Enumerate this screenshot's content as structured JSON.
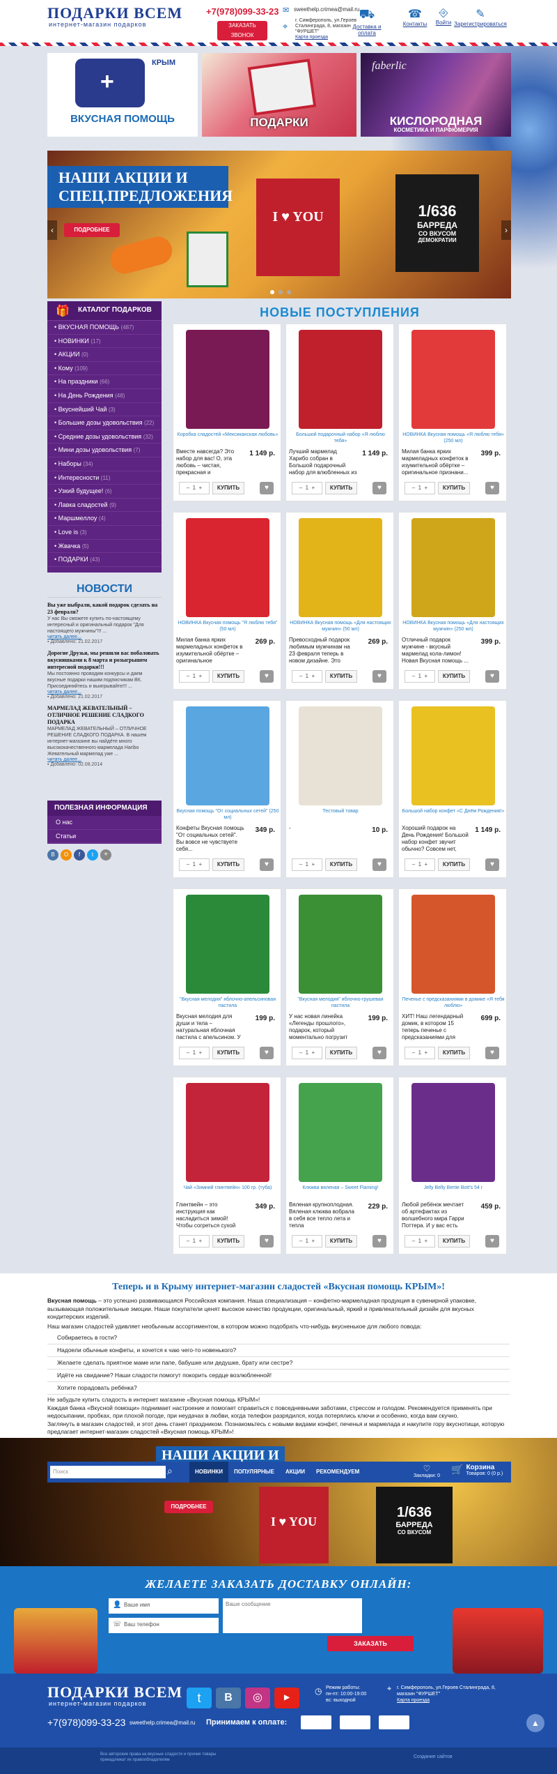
{
  "header": {
    "logo_title": "ПОДАРКИ ВСЕМ",
    "logo_subtitle": "интернет-магазин подарков",
    "phone": "+7(978)099-33-23",
    "callback_label": "ЗАКАЗАТЬ ЗВОНОК",
    "email": "sweethelp.crimea@mail.ru",
    "address_lines": [
      "г. Симферополь, ул.Героев",
      "Сталинграда, 8, магазин",
      "\"ФУРШЕТ\""
    ],
    "map_link": "Карта проезда",
    "nav": [
      "Доставка и оплата",
      "Контакты",
      "Войти",
      "Зарегистрироваться"
    ]
  },
  "banners": [
    {
      "title": "ВКУСНАЯ ПОМОЩЬ",
      "top_label": "КРЫМ"
    },
    {
      "title": "ПОДАРКИ"
    },
    {
      "title": "КИСЛОРОДНАЯ",
      "subtitle": "КОСМЕТИКА И ПАРФЮМЕРИЯ",
      "brand": "faberlic"
    }
  ],
  "slider": {
    "title_line1": "НАШИ АКЦИИ И",
    "title_line2": "СПЕЦ.ПРЕДЛОЖЕНИЯ",
    "button": "ПОДРОБНЕЕ",
    "box1": "I ♥ YOU",
    "box2_line1": "1/636",
    "box2_line2": "БАРРЕДА",
    "box2_line3": "СО ВКУСОМ",
    "box2_line4": "ДЕМОКРАТИИ"
  },
  "catalog": {
    "title": "КАТАЛОГ ПОДАРКОВ",
    "items": [
      {
        "label": "ВКУСНАЯ ПОМОЩЬ",
        "count": "(487)"
      },
      {
        "label": "НОВИНКИ",
        "count": "(17)"
      },
      {
        "label": "АКЦИИ",
        "count": "(0)"
      },
      {
        "label": "Кому",
        "count": "(109)"
      },
      {
        "label": "На праздники",
        "count": "(66)"
      },
      {
        "label": "На День Рождения",
        "count": "(48)"
      },
      {
        "label": "Вкуснейший Чай",
        "count": "(3)"
      },
      {
        "label": "Большие дозы удовольствия",
        "count": "(22)"
      },
      {
        "label": "Средние дозы удовольствия",
        "count": "(32)"
      },
      {
        "label": "Мини дозы удовольствия",
        "count": "(7)"
      },
      {
        "label": "Наборы",
        "count": "(34)"
      },
      {
        "label": "Интересности",
        "count": "(11)"
      },
      {
        "label": "Узкий будущее!",
        "count": "(6)"
      },
      {
        "label": "Лавка сладостей",
        "count": "(9)"
      },
      {
        "label": "Маршмеллоу",
        "count": "(4)"
      },
      {
        "label": "Love is",
        "count": "(3)"
      },
      {
        "label": "Жвачка",
        "count": "(5)"
      },
      {
        "label": "ПОДАРКИ",
        "count": "(43)"
      }
    ]
  },
  "news": {
    "title": "НОВОСТИ",
    "items": [
      {
        "title": "Вы уже выбрали, какой подарок сделать на 23 февраля?",
        "text": "У нас Вы сможете купить по-настоящему интересный и оригинальный подарок \"Для настоящего мужчины\"!!! ...",
        "more": "читать далее...",
        "date": "Добавлено: 21.02.2017"
      },
      {
        "title": "Дорогие Друзья, мы решили вас побаловать вкусняшками к 8 марта и розыгрышем интересной подарки!!!",
        "text": "Мы постоянно проводим конкурсы и даем вкусные подарки нашим подписчикам ВК. Присоединяйтесь и выигрывайте!!! ...",
        "more": "читать далее...",
        "date": "Добавлено: 21.02.2017"
      },
      {
        "title": "МАРМЕЛАД ЖЕВАТЕЛЬНЫЙ – ОТЛИЧНОЕ РЕШЕНИЕ СЛАДКОГО ПОДАРКА",
        "text": "МАРМЕЛАД ЖЕВАТЕЛЬНЫЙ – ОТЛИЧНОЕ РЕШЕНИЕ СЛАДКОГО ПОДАРКА. В нашем интернет-магазине вы найдёте много высококачественного мармелада Haribo Жевательный мармелад уже ...",
        "more": "читать далее...",
        "date": "Добавлено: 02.08.2014"
      }
    ]
  },
  "info": {
    "title": "ПОЛЕЗНАЯ ИНФОРМАЦИЯ",
    "items": [
      "О нас",
      "Статьи"
    ]
  },
  "new_arrivals": {
    "title": "НОВЫЕ ПОСТУПЛЕНИЯ",
    "qty_default": "1",
    "buy_label": "КУПИТЬ"
  },
  "products": [
    {
      "name": "Коробка сладостей «Мексиканская любовь»",
      "desc": "Вместе навсегда? Это набор для вас! О, эта любовь – чистая, прекрасная и",
      "price": "1 149 р.",
      "color": "#7a1a54"
    },
    {
      "name": "Большой подарочный набор «Я люблю тебя»",
      "desc": "Лучший мармелад Харибо собран в Большой подарочный набор для влюбленных из 9",
      "price": "1 149 р.",
      "color": "#c0202c"
    },
    {
      "name": "НОВИНКА Вкусная помощь «Я люблю тебя» (250 мл)",
      "desc": "Милая банка ярких мармеладных конфеток в изумительной обёртке – оригинальное признани...",
      "price": "399 р.",
      "color": "#e23a3a"
    },
    {
      "name": "НОВИНКА Вкусная помощь \"Я люблю тебя\" (50 мл)",
      "desc": "Милая банка ярких мармеладных конфеток в изумительной обёртке – оригинальное признание...",
      "price": "269 р.",
      "color": "#d8252f"
    },
    {
      "name": "НОВИНКА Вкусная помощь «Для настоящих мужчин» (50 мл)",
      "desc": "Превосходный подарок любимым мужчинам на 23 февраля теперь в новом дизайне. Это",
      "price": "269 р.",
      "color": "#e2b41a"
    },
    {
      "name": "НОВИНКА Вкусная помощь «Для настоящих мужчин» (250 мл)",
      "desc": "Отличный подарок мужчине - вкусный мармелад кола-лимон! Новая Вкусная помощь ...",
      "price": "399 р.",
      "color": "#cfa619"
    },
    {
      "name": "Вкусная помощь \"От социальных сетей\" (250 мл)",
      "desc": "Конфеты Вкусная помощь \"От социальных сетей\". Вы вовсе не чувствуете себя...",
      "price": "349 р.",
      "color": "#5aa6e0"
    },
    {
      "name": "Тестовый товар",
      "desc": "-",
      "price": "10 р.",
      "color": "#e8e2d6"
    },
    {
      "name": "Большой набор конфет «С Днём Рождения!»",
      "desc": "Хороший подарок на День Рождения! Большой набор конфет звучит обычно? Совсем нет,",
      "price": "1 149 р.",
      "color": "#e9c121"
    },
    {
      "name": "\"Вкусная мелодия\" яблочно-апельсиновая пастила",
      "desc": "Вкусная мелодия для души и тела – натуральная яблочная пастила с апельсином. У",
      "price": "199 р.",
      "color": "#2a8a3a"
    },
    {
      "name": "\"Вкусная мелодия\" яблочно-грушевая пастила",
      "desc": "У нас новая линейка «Легенды прошлого», подарок, который моментально погрузит вас",
      "price": "199 р.",
      "color": "#3b8f35"
    },
    {
      "name": "Печенье с предсказаниями в домике «Я тебя люблю»",
      "desc": "ХИТ! Наш легендарный домик, в котором 15 теперь печенье с предсказаниями для",
      "price": "699 р.",
      "color": "#d6562c"
    },
    {
      "name": "Чай «Зимний глинтвейн» 100 гр. (туба)",
      "desc": "Глинтвейн – это инструкция как насладиться зимой! Чтобы согреться сухой",
      "price": "349 р.",
      "color": "#c3243a"
    },
    {
      "name": "Клюква вяленая – Sweet Flaming!",
      "desc": "Вяленая крупноплодная. Вяленая клюква вобрала в себя все тепло лета и тепла",
      "price": "229 р.",
      "color": "#45a34d"
    },
    {
      "name": "Jelly Belly Bertie Bott's 54 г",
      "desc": "Любой ребёнок мечтает об артефактах из волшебного мира Гарри Поттера. И у вас есть",
      "price": "459 р.",
      "color": "#6a2e8a"
    }
  ],
  "about": {
    "title": "Теперь и в Крыму интернет-магазин сладостей «Вкусная помощь КРЫМ»!",
    "p1_bold": "Вкусная помощь",
    "p1": " – это успешно развивающаяся Российская компания. Наша специализация – конфетно-мармеладная продукция в сувенирной упаковке, вызывающая положительные эмоции. Наши покупатели ценят высокое качество продукции, оригинальный, яркий и привлекательный дизайн для вкусных кондитерских изделий.",
    "p2": "Наш магазин сладостей удивляет необычным ассортиментом, в котором можно подобрать что-нибудь вкусненькое для любого повода:",
    "list": [
      "Собираетесь в гости?",
      "Надоели обычные конфеты, и хочется к чаю чего-то новенького?",
      "Желаете сделать приятное маме или папе, бабушке или дедушке, брату или сестре?",
      "Идёте на свидание? Наши сладости помогут покорить сердце возлюбленной!",
      "Хотите порадовать ребёнка?"
    ],
    "p3": "Не забудьте купить сладость в интернет магазине «Вкусная помощь КРЫМ»!",
    "p4": "Каждая банка «Вкусной помощи» поднимает настроение и помогает справиться с повседневными забот­ами, стрессом и голодом. Рекомендуется применять при недосыпании, пробках, при плохой погоде, при неудачах в любви, когда телефон разрядился, когда потерялись ключи и особенно, когда вам скучно.",
    "p5": "Заглянуть в магазин сладостей, и этот день станет праздником. Познакомьтесь с новыми видами конфет, печенья и мармелада и накупите гору вкуснотищи, которую предлагает интернет-магазин сладостей «Вкусная помощь КРЫМ»!"
  },
  "bottom_bar": {
    "search_placeholder": "Поиск",
    "tabs": [
      "НОВИНКИ",
      "ПОПУЛЯРНЫЕ",
      "АКЦИИ",
      "РЕКОМЕНДУЕМ"
    ],
    "favorites": "Закладки: 0",
    "cart_title": "Корзина",
    "cart_info": "Товаров: 0 (0 р.)",
    "promo_title": "НАШИ АКЦИИ И",
    "promo_button": "ПОДРОБНЕЕ"
  },
  "order": {
    "title": "ЖЕЛАЕТЕ ЗАКАЗАТЬ ДОСТАВКУ ОНЛАЙН:",
    "name_placeholder": "Ваше имя",
    "phone_placeholder": "Ваш телефон",
    "message_placeholder": "Ваше сообщение",
    "submit": "ЗАКАЗАТЬ"
  },
  "footer": {
    "logo_title": "ПОДАРКИ ВСЕМ",
    "logo_subtitle": "интернет-магазин подарков",
    "hours": [
      "Режим работы:",
      "пн-пт: 10:00-19:00",
      "вс: выходной"
    ],
    "address": "г. Симферополь, ул.Героев Сталинграда, 8, магазин \"ФУРШЕТ\"",
    "map_link": "Карта проезда",
    "phone": "+7(978)099-33-23",
    "email": "sweethelp.crimea@mail.ru",
    "pay_label": "Принимаем к оплате:",
    "copyright": "Все авторские права на вкусные сладости и прочие товары принадлежат их правообладателям",
    "dev": "Создание сайтов"
  },
  "colors": {
    "brand_blue": "#1f3f95",
    "accent_red": "#d81e3a",
    "catalog_purple": "#5e2482",
    "footer_blue": "#1f4fa8",
    "link_blue": "#2b82c6"
  }
}
